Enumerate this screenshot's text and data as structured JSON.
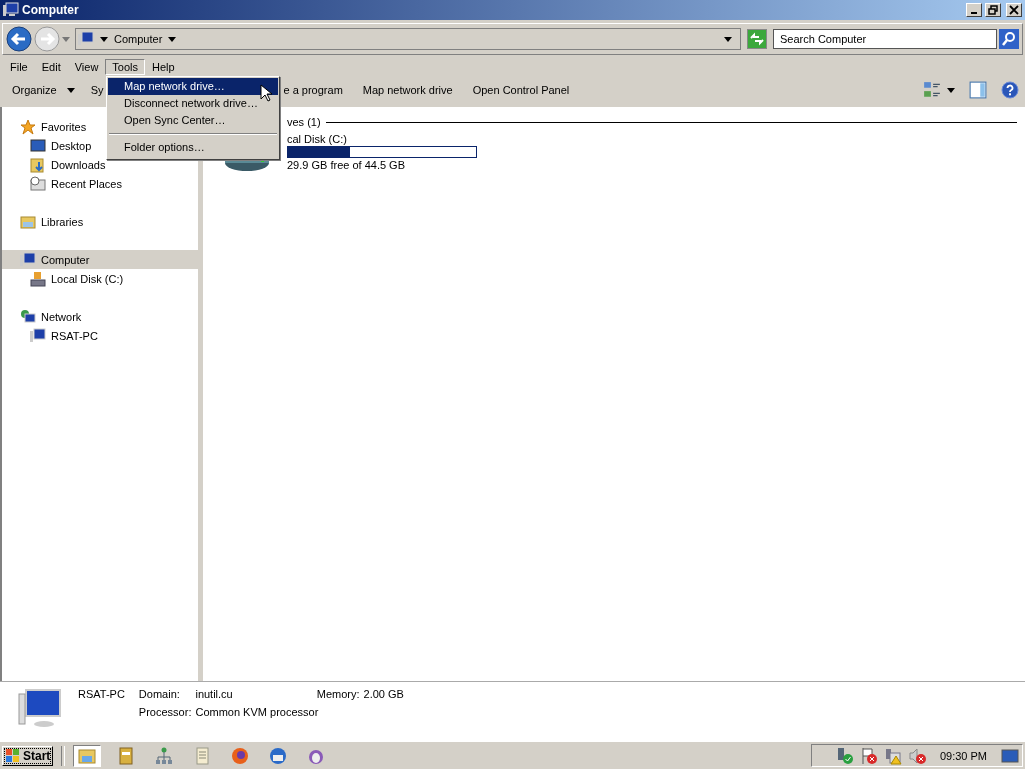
{
  "window": {
    "title": "Computer"
  },
  "address_bar": {
    "location": "Computer",
    "search": {
      "placeholder": "Search Computer"
    }
  },
  "menu_bar": [
    {
      "label": "File",
      "selected": false
    },
    {
      "label": "Edit",
      "selected": false
    },
    {
      "label": "View",
      "selected": false
    },
    {
      "label": "Tools",
      "selected": true
    },
    {
      "label": "Help",
      "selected": false
    }
  ],
  "tools_menu": [
    {
      "kind": "item",
      "label": "Map network drive…",
      "selected": true
    },
    {
      "kind": "item",
      "label": "Disconnect network drive…",
      "selected": false
    },
    {
      "kind": "item",
      "label": "Open Sync Center…",
      "selected": false
    },
    {
      "kind": "separator"
    },
    {
      "kind": "item",
      "label": "Folder options…",
      "selected": false
    }
  ],
  "command_bar": [
    {
      "label": "Organize",
      "dropdown": true
    },
    {
      "label": "Sy"
    },
    {
      "label": "e a program"
    },
    {
      "label": "Map network drive"
    },
    {
      "label": "Open Control Panel"
    }
  ],
  "sidebar": [
    {
      "label": "Favorites",
      "selected": false,
      "children": [
        {
          "label": "Desktop",
          "selected": false
        },
        {
          "label": "Downloads",
          "selected": false
        },
        {
          "label": "Recent Places",
          "selected": false
        }
      ]
    },
    {
      "label": "Libraries",
      "selected": false
    },
    {
      "label": "Computer",
      "selected": true,
      "children": [
        {
          "label": "Local Disk (C:)",
          "selected": false
        }
      ]
    },
    {
      "label": "Network",
      "selected": false,
      "children": [
        {
          "label": "RSAT-PC",
          "selected": false
        }
      ]
    }
  ],
  "content": {
    "group_header": "ves (1)",
    "drives": [
      {
        "name": "cal Disk (C:)",
        "level": 0.33,
        "free_text": "29.9 GB free of 44.5 GB"
      }
    ]
  },
  "details_pane": {
    "name": "RSAT-PC",
    "domain_label": "Domain:",
    "domain": "inutil.cu",
    "memory_label": "Memory:",
    "memory": "2.00 GB",
    "processor_label": "Processor:",
    "processor": "Common KVM processor"
  },
  "taskbar": {
    "start": "Start",
    "apps": [
      {
        "selected": true
      },
      {
        "selected": false
      },
      {
        "selected": false
      },
      {
        "selected": false
      },
      {
        "selected": false
      },
      {
        "selected": false
      },
      {
        "selected": false
      }
    ],
    "clock": "09:30 PM"
  }
}
